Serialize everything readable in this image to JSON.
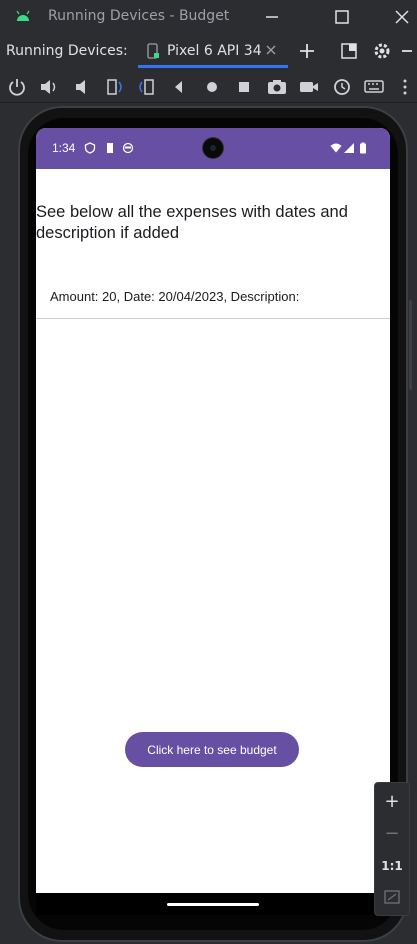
{
  "window": {
    "title": "Running Devices - Budget"
  },
  "tabs": {
    "label": "Running Devices:",
    "active_tab": "Pixel 6 API 34"
  },
  "toolbar": {
    "icons": [
      "power-icon",
      "volume-up-icon",
      "volume-down-icon",
      "rotate-left-icon",
      "rotate-right-icon",
      "back-icon",
      "home-icon",
      "overview-icon",
      "screenshot-icon",
      "screen-record-icon",
      "snapshot-icon",
      "keyboard-icon",
      "more-icon"
    ]
  },
  "device": {
    "status_time": "1:34",
    "colors": {
      "primary": "#6750a4",
      "background": "#ffffff"
    }
  },
  "app": {
    "heading": "See below all the expenses with dates and description if added",
    "expenses": [
      {
        "text": "Amount: 20, Date: 20/04/2023, Description:"
      }
    ],
    "budget_button": "Click here to see budget"
  },
  "zoom": {
    "plus": "+",
    "minus": "−",
    "one_to_one": "1:1"
  }
}
